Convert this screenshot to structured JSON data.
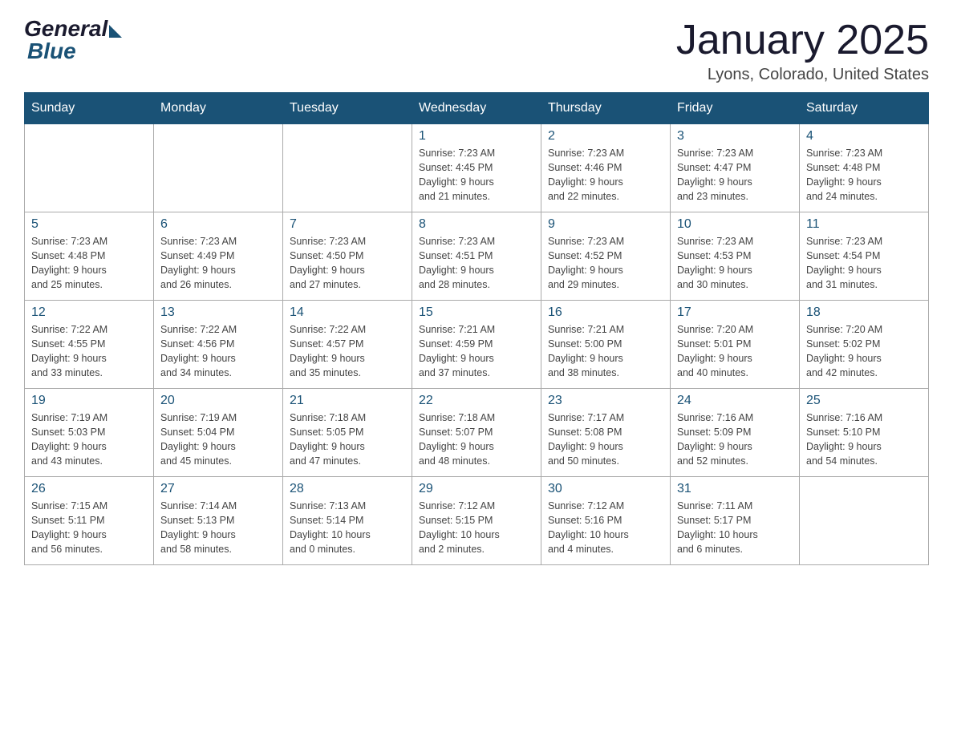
{
  "header": {
    "logo_general": "General",
    "logo_blue": "Blue",
    "title": "January 2025",
    "location": "Lyons, Colorado, United States"
  },
  "days_of_week": [
    "Sunday",
    "Monday",
    "Tuesday",
    "Wednesday",
    "Thursday",
    "Friday",
    "Saturday"
  ],
  "weeks": [
    [
      {
        "day": "",
        "info": ""
      },
      {
        "day": "",
        "info": ""
      },
      {
        "day": "",
        "info": ""
      },
      {
        "day": "1",
        "info": "Sunrise: 7:23 AM\nSunset: 4:45 PM\nDaylight: 9 hours\nand 21 minutes."
      },
      {
        "day": "2",
        "info": "Sunrise: 7:23 AM\nSunset: 4:46 PM\nDaylight: 9 hours\nand 22 minutes."
      },
      {
        "day": "3",
        "info": "Sunrise: 7:23 AM\nSunset: 4:47 PM\nDaylight: 9 hours\nand 23 minutes."
      },
      {
        "day": "4",
        "info": "Sunrise: 7:23 AM\nSunset: 4:48 PM\nDaylight: 9 hours\nand 24 minutes."
      }
    ],
    [
      {
        "day": "5",
        "info": "Sunrise: 7:23 AM\nSunset: 4:48 PM\nDaylight: 9 hours\nand 25 minutes."
      },
      {
        "day": "6",
        "info": "Sunrise: 7:23 AM\nSunset: 4:49 PM\nDaylight: 9 hours\nand 26 minutes."
      },
      {
        "day": "7",
        "info": "Sunrise: 7:23 AM\nSunset: 4:50 PM\nDaylight: 9 hours\nand 27 minutes."
      },
      {
        "day": "8",
        "info": "Sunrise: 7:23 AM\nSunset: 4:51 PM\nDaylight: 9 hours\nand 28 minutes."
      },
      {
        "day": "9",
        "info": "Sunrise: 7:23 AM\nSunset: 4:52 PM\nDaylight: 9 hours\nand 29 minutes."
      },
      {
        "day": "10",
        "info": "Sunrise: 7:23 AM\nSunset: 4:53 PM\nDaylight: 9 hours\nand 30 minutes."
      },
      {
        "day": "11",
        "info": "Sunrise: 7:23 AM\nSunset: 4:54 PM\nDaylight: 9 hours\nand 31 minutes."
      }
    ],
    [
      {
        "day": "12",
        "info": "Sunrise: 7:22 AM\nSunset: 4:55 PM\nDaylight: 9 hours\nand 33 minutes."
      },
      {
        "day": "13",
        "info": "Sunrise: 7:22 AM\nSunset: 4:56 PM\nDaylight: 9 hours\nand 34 minutes."
      },
      {
        "day": "14",
        "info": "Sunrise: 7:22 AM\nSunset: 4:57 PM\nDaylight: 9 hours\nand 35 minutes."
      },
      {
        "day": "15",
        "info": "Sunrise: 7:21 AM\nSunset: 4:59 PM\nDaylight: 9 hours\nand 37 minutes."
      },
      {
        "day": "16",
        "info": "Sunrise: 7:21 AM\nSunset: 5:00 PM\nDaylight: 9 hours\nand 38 minutes."
      },
      {
        "day": "17",
        "info": "Sunrise: 7:20 AM\nSunset: 5:01 PM\nDaylight: 9 hours\nand 40 minutes."
      },
      {
        "day": "18",
        "info": "Sunrise: 7:20 AM\nSunset: 5:02 PM\nDaylight: 9 hours\nand 42 minutes."
      }
    ],
    [
      {
        "day": "19",
        "info": "Sunrise: 7:19 AM\nSunset: 5:03 PM\nDaylight: 9 hours\nand 43 minutes."
      },
      {
        "day": "20",
        "info": "Sunrise: 7:19 AM\nSunset: 5:04 PM\nDaylight: 9 hours\nand 45 minutes."
      },
      {
        "day": "21",
        "info": "Sunrise: 7:18 AM\nSunset: 5:05 PM\nDaylight: 9 hours\nand 47 minutes."
      },
      {
        "day": "22",
        "info": "Sunrise: 7:18 AM\nSunset: 5:07 PM\nDaylight: 9 hours\nand 48 minutes."
      },
      {
        "day": "23",
        "info": "Sunrise: 7:17 AM\nSunset: 5:08 PM\nDaylight: 9 hours\nand 50 minutes."
      },
      {
        "day": "24",
        "info": "Sunrise: 7:16 AM\nSunset: 5:09 PM\nDaylight: 9 hours\nand 52 minutes."
      },
      {
        "day": "25",
        "info": "Sunrise: 7:16 AM\nSunset: 5:10 PM\nDaylight: 9 hours\nand 54 minutes."
      }
    ],
    [
      {
        "day": "26",
        "info": "Sunrise: 7:15 AM\nSunset: 5:11 PM\nDaylight: 9 hours\nand 56 minutes."
      },
      {
        "day": "27",
        "info": "Sunrise: 7:14 AM\nSunset: 5:13 PM\nDaylight: 9 hours\nand 58 minutes."
      },
      {
        "day": "28",
        "info": "Sunrise: 7:13 AM\nSunset: 5:14 PM\nDaylight: 10 hours\nand 0 minutes."
      },
      {
        "day": "29",
        "info": "Sunrise: 7:12 AM\nSunset: 5:15 PM\nDaylight: 10 hours\nand 2 minutes."
      },
      {
        "day": "30",
        "info": "Sunrise: 7:12 AM\nSunset: 5:16 PM\nDaylight: 10 hours\nand 4 minutes."
      },
      {
        "day": "31",
        "info": "Sunrise: 7:11 AM\nSunset: 5:17 PM\nDaylight: 10 hours\nand 6 minutes."
      },
      {
        "day": "",
        "info": ""
      }
    ]
  ]
}
